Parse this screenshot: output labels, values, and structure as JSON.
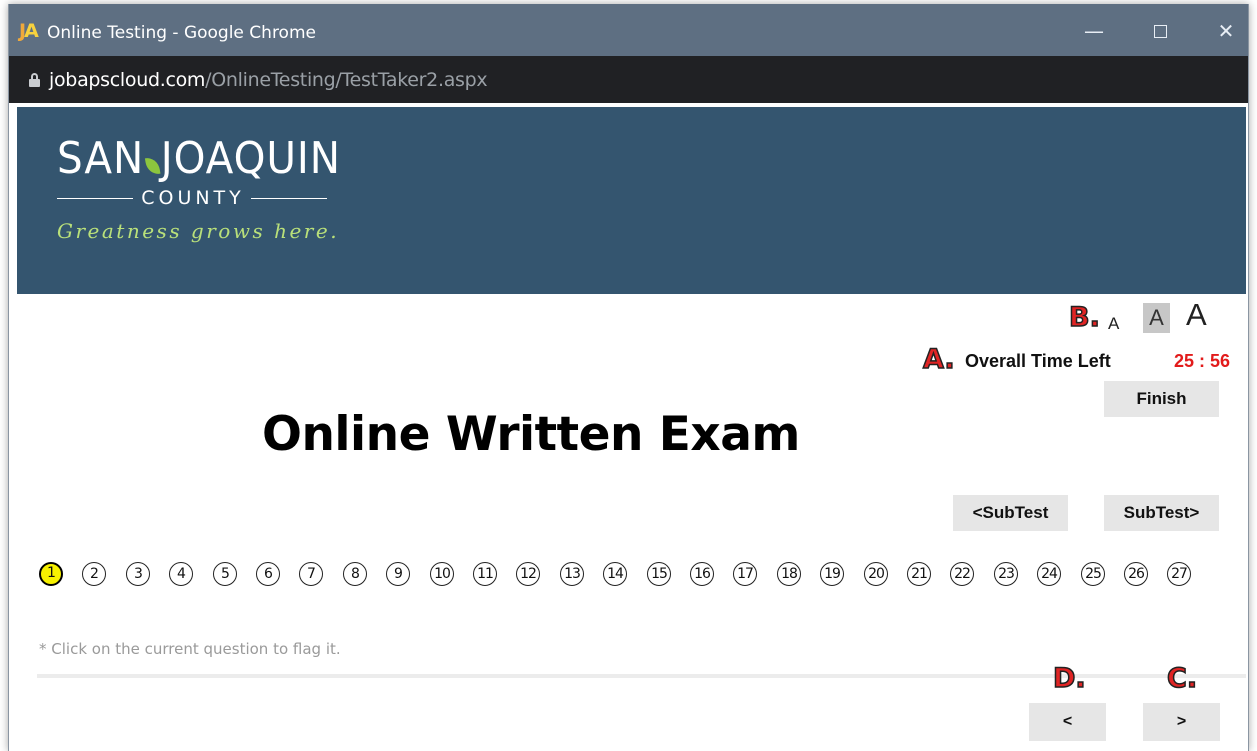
{
  "browser": {
    "window_title": "Online Testing - Google Chrome",
    "url_host": "jobapscloud.com",
    "url_path": "/OnlineTesting/TestTaker2.aspx",
    "controls": {
      "minimize": "—",
      "close": "✕"
    }
  },
  "banner": {
    "logo_left": "SAN",
    "logo_right": "JOAQUIN",
    "logo_county": "COUNTY",
    "tagline": "Greatness grows here."
  },
  "annotations": {
    "a": "A.",
    "b": "B.",
    "c": "C.",
    "d": "D."
  },
  "font_sizes": {
    "small": "A",
    "medium": "A",
    "large": "A"
  },
  "timer": {
    "label": "Overall Time Left",
    "value": "25 : 56"
  },
  "buttons": {
    "finish": "Finish",
    "subtest_prev": "<SubTest",
    "subtest_next": "SubTest>",
    "prev": "<",
    "next": ">"
  },
  "exam_title": "Online Written Exam",
  "questions": {
    "current": 1,
    "numbers": [
      "1",
      "2",
      "3",
      "4",
      "5",
      "6",
      "7",
      "8",
      "9",
      "10",
      "11",
      "12",
      "13",
      "14",
      "15",
      "16",
      "17",
      "18",
      "19",
      "20",
      "21",
      "22",
      "23",
      "24",
      "25",
      "26",
      "27"
    ]
  },
  "hint": "* Click on the current question to flag it.",
  "colors": {
    "banner": "#34556f",
    "timer": "#e21b1b",
    "current_question": "#f7f100",
    "annotation": "#e02424"
  }
}
